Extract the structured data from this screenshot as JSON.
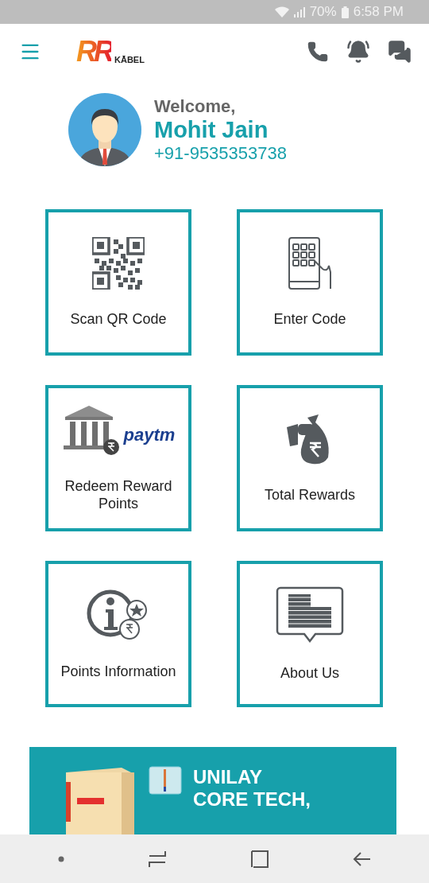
{
  "status_bar": {
    "battery": "70%",
    "time": "6:58 PM"
  },
  "header": {
    "logo": {
      "mark": "RR",
      "word": "KĀBEL"
    }
  },
  "profile": {
    "greeting": "Welcome,",
    "name": "Mohit Jain",
    "phone": "+91-9535353738"
  },
  "tiles": [
    {
      "kind": "qr",
      "label": "Scan QR Code"
    },
    {
      "kind": "keypad",
      "label": "Enter Code"
    },
    {
      "kind": "redeem",
      "label": "Redeem Reward Points",
      "brand": "paytm"
    },
    {
      "kind": "money",
      "label": "Total Rewards"
    },
    {
      "kind": "info",
      "label": "Points Information"
    },
    {
      "kind": "about",
      "label": "About Us"
    }
  ],
  "banner": {
    "lines": [
      "UNILAY",
      "CORE TECH,"
    ]
  }
}
